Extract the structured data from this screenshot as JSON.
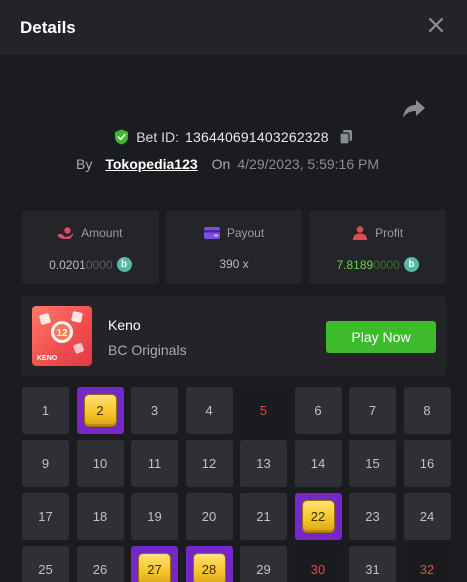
{
  "header": {
    "title": "Details"
  },
  "bet": {
    "id_label": "Bet ID:",
    "id_value": "136440691403262328",
    "by_label": "By",
    "username": "Tokopedia123",
    "on_label": "On",
    "datetime": "4/29/2023, 5:59:16 PM"
  },
  "stats": {
    "amount": {
      "label": "Amount",
      "value_main": "0.0201",
      "value_trailing": "0000",
      "coin": "b"
    },
    "payout": {
      "label": "Payout",
      "value": "390 x"
    },
    "profit": {
      "label": "Profit",
      "value_main": "7.8189",
      "value_trailing": "0000",
      "coin": "b"
    }
  },
  "game": {
    "name": "Keno",
    "provider": "BC Originals",
    "play_label": "Play Now",
    "thumb_text": "KENO",
    "thumb_ball": "12"
  },
  "colors": {
    "accent_green": "#3dbb2d",
    "hit_purple": "#7428c8",
    "miss_red": "#e04a4a",
    "coin_teal": "#55b9a5"
  },
  "grid": {
    "cells": [
      {
        "n": "1",
        "s": "normal"
      },
      {
        "n": "2",
        "s": "hit"
      },
      {
        "n": "3",
        "s": "normal"
      },
      {
        "n": "4",
        "s": "normal"
      },
      {
        "n": "5",
        "s": "miss"
      },
      {
        "n": "6",
        "s": "normal"
      },
      {
        "n": "7",
        "s": "normal"
      },
      {
        "n": "8",
        "s": "normal"
      },
      {
        "n": "9",
        "s": "normal"
      },
      {
        "n": "10",
        "s": "normal"
      },
      {
        "n": "11",
        "s": "normal"
      },
      {
        "n": "12",
        "s": "normal"
      },
      {
        "n": "13",
        "s": "normal"
      },
      {
        "n": "14",
        "s": "normal"
      },
      {
        "n": "15",
        "s": "normal"
      },
      {
        "n": "16",
        "s": "normal"
      },
      {
        "n": "17",
        "s": "normal"
      },
      {
        "n": "18",
        "s": "normal"
      },
      {
        "n": "19",
        "s": "normal"
      },
      {
        "n": "20",
        "s": "normal"
      },
      {
        "n": "21",
        "s": "normal"
      },
      {
        "n": "22",
        "s": "hit"
      },
      {
        "n": "23",
        "s": "normal"
      },
      {
        "n": "24",
        "s": "normal"
      },
      {
        "n": "25",
        "s": "normal"
      },
      {
        "n": "26",
        "s": "normal"
      },
      {
        "n": "27",
        "s": "hit"
      },
      {
        "n": "28",
        "s": "hit"
      },
      {
        "n": "29",
        "s": "normal"
      },
      {
        "n": "30",
        "s": "miss"
      },
      {
        "n": "31",
        "s": "normal"
      },
      {
        "n": "32",
        "s": "miss"
      }
    ]
  }
}
